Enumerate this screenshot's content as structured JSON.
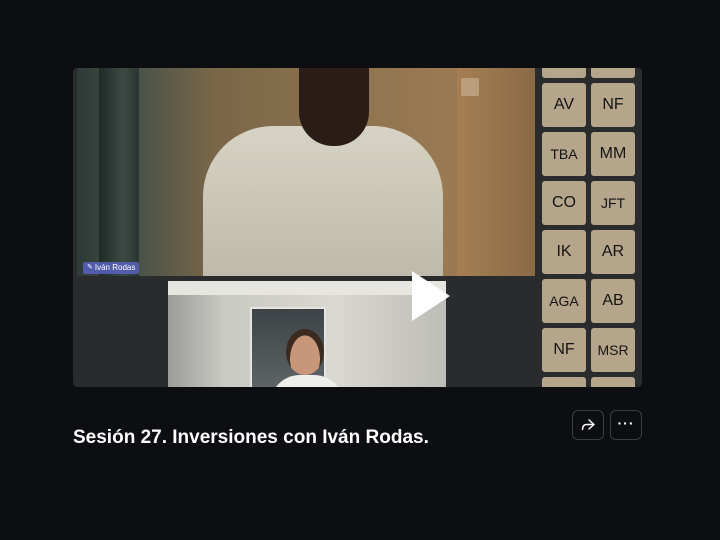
{
  "video": {
    "main_speaker_label": "Iván Rodas",
    "participants": [
      {
        "initials": ""
      },
      {
        "initials": ""
      },
      {
        "initials": "AV"
      },
      {
        "initials": "NF"
      },
      {
        "initials": "TBA"
      },
      {
        "initials": "MM"
      },
      {
        "initials": "CO"
      },
      {
        "initials": "JFT"
      },
      {
        "initials": "IK"
      },
      {
        "initials": "AR"
      },
      {
        "initials": "AGA"
      },
      {
        "initials": "AB"
      },
      {
        "initials": "NF"
      },
      {
        "initials": "MSR"
      },
      {
        "initials": ""
      },
      {
        "initials": ""
      }
    ],
    "play_icon": "play-icon"
  },
  "title": "Sesión 27. Inversiones con Iván Rodas.",
  "actions": {
    "share_icon": "share-icon",
    "more_icon": "more-icon"
  },
  "colors": {
    "background": "#0c0e11",
    "tile": "#b4a58b",
    "speaker_label": "#5860be"
  }
}
